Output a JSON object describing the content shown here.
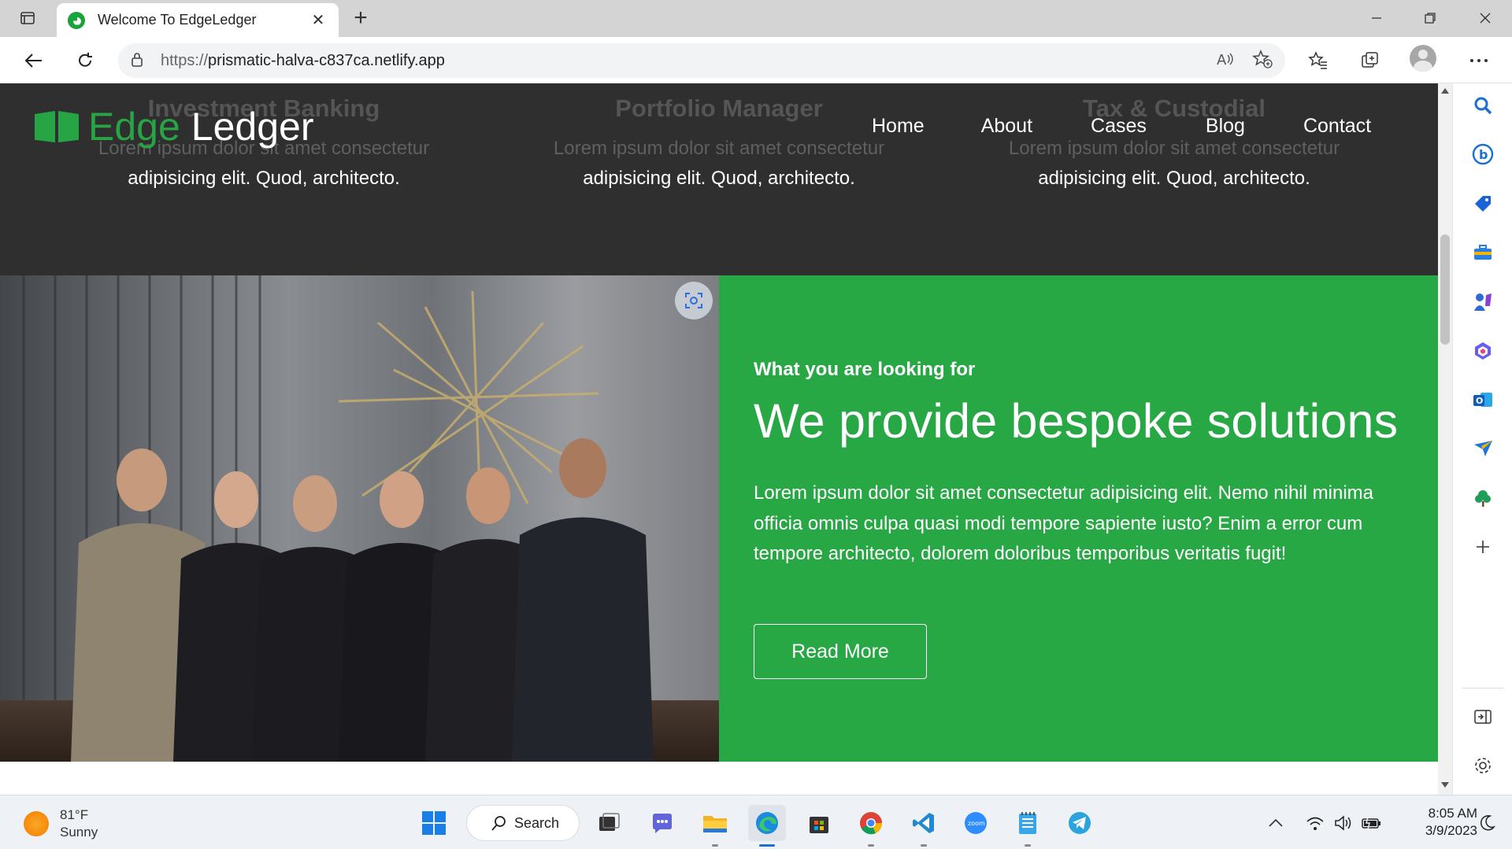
{
  "browser": {
    "tab_title": "Welcome To EdgeLedger",
    "url_prefix": "https://",
    "url_host": "prismatic-halva-c837ca.netlify.app"
  },
  "site": {
    "logo_part1": "Edge",
    "logo_part2": "Ledger",
    "nav": [
      "Home",
      "About",
      "Cases",
      "Blog",
      "Contact"
    ],
    "services": [
      {
        "title": "Investment Banking",
        "line1": "Lorem ipsum dolor sit amet consectetur",
        "line2": "adipisicing elit. Quod, architecto."
      },
      {
        "title": "Portfolio Manager",
        "line1": "Lorem ipsum dolor sit amet consectetur",
        "line2": "adipisicing elit. Quod, architecto."
      },
      {
        "title": "Tax & Custodial",
        "line1": "Lorem ipsum dolor sit amet consectetur",
        "line2": "adipisicing elit. Quod, architecto."
      }
    ],
    "hero": {
      "kicker": "What you are looking for",
      "heading": "We provide bespoke solutions",
      "body": "Lorem ipsum dolor sit amet consectetur adipisicing elit. Nemo nihil minima officia omnis culpa quasi modi tempore sapiente iusto? Enim a error cum tempore architecto, dolorem doloribus temporibus veritatis fugit!",
      "button": "Read More"
    }
  },
  "taskbar": {
    "temperature": "81°F",
    "condition": "Sunny",
    "search_label": "Search",
    "time": "8:05 AM",
    "date": "3/9/2023"
  },
  "colors": {
    "brand_green": "#28a745",
    "dark_band": "#2f2f2f"
  }
}
